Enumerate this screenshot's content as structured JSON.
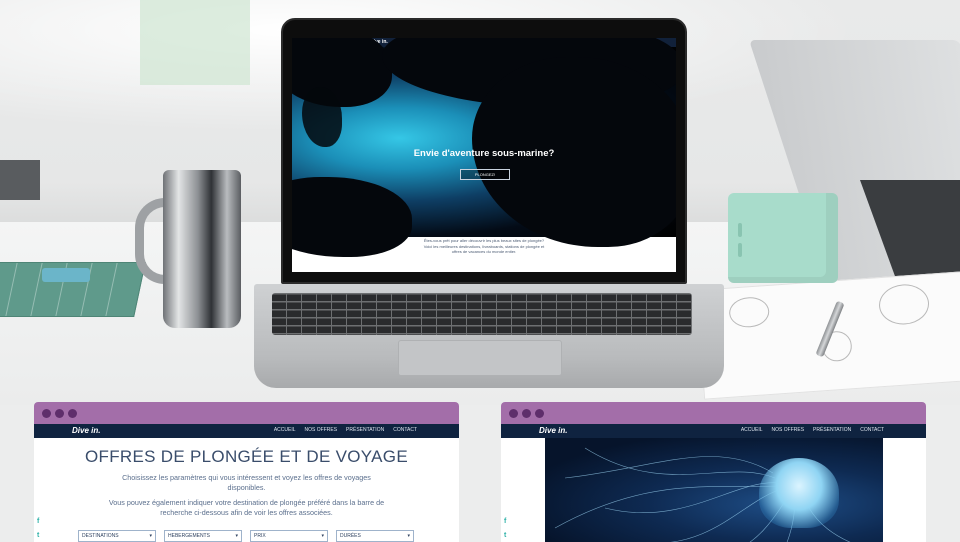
{
  "laptop_site": {
    "logo": "Dive in.",
    "nav": [
      "ACCUEIL",
      "NOS OFFRES",
      "PRÉSENTATION",
      "CONTACT"
    ],
    "hero_title": "Envie d'aventure sous-marine?",
    "hero_button": "PLONGEZ!",
    "intro_line1": "Êtes-vous prêt pour aller découvrir les plus beaux sites de plongée?",
    "intro_line2": "Voici les meilleures destinations, liveaboards, stations de plongée et",
    "intro_line3": "offres de vacances du monde entier."
  },
  "left_browser": {
    "logo": "Dive in.",
    "nav": [
      "ACCUEIL",
      "NOS OFFRES",
      "PRÉSENTATION",
      "CONTACT"
    ],
    "heading": "OFFRES DE PLONGÉE ET DE VOYAGE",
    "paragraph1": "Choisissez les paramètres qui vous intéressent et voyez les offres de voyages disponibles.",
    "paragraph2": "Vous pouvez également indiquer votre destination de plongée préféré dans la barre de recherche ci-dessous afin de voir les offres associées.",
    "social": [
      "f",
      "t"
    ],
    "filters": [
      "DESTINATIONS",
      "HEBERGEMENTS",
      "PRIX",
      "DURÉES"
    ]
  },
  "right_browser": {
    "logo": "Dive in.",
    "nav": [
      "ACCUEIL",
      "NOS OFFRES",
      "PRÉSENTATION",
      "CONTACT"
    ],
    "social": [
      "f",
      "t"
    ]
  },
  "colors": {
    "titlebar": "#a36ea9",
    "window_dots": "#5e2e6b",
    "navbar": "#0f2340",
    "accent_social": "#2bb0a7"
  }
}
